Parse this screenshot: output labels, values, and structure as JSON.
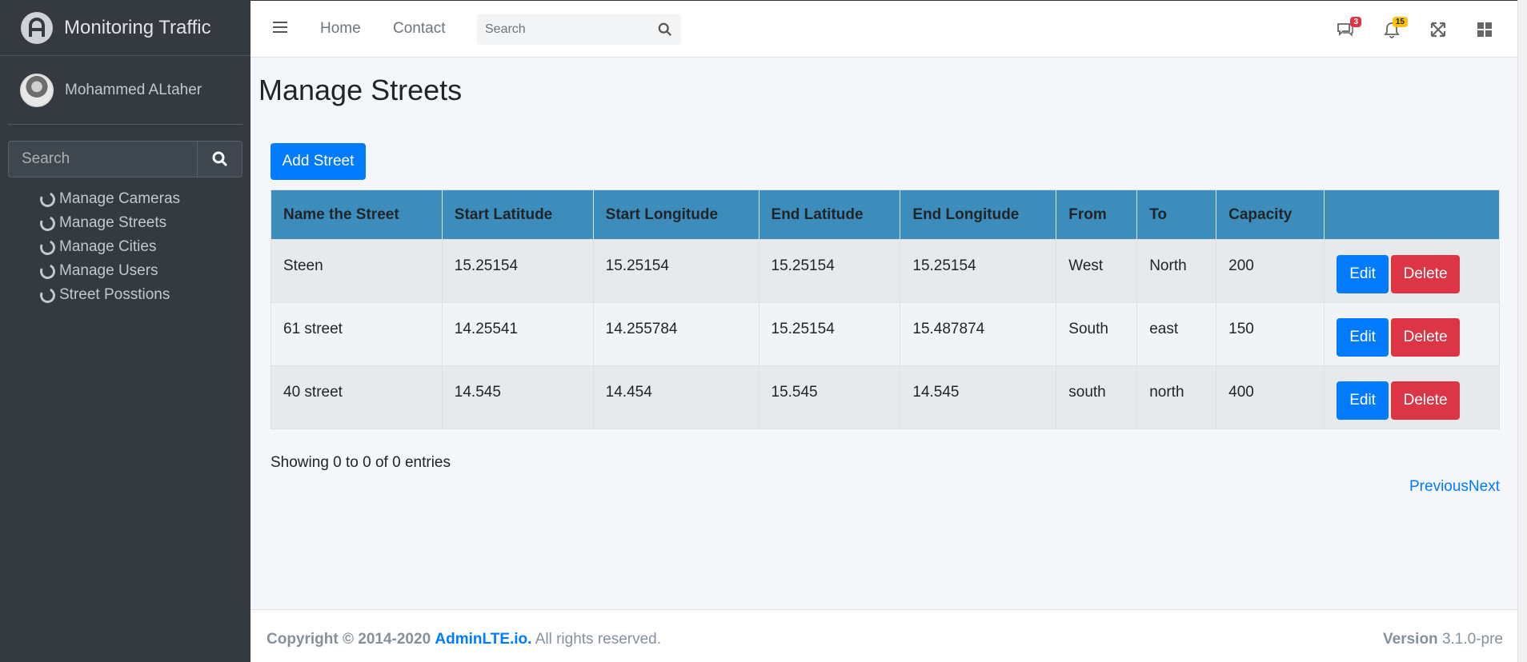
{
  "brand": {
    "title": "Monitoring Traffic"
  },
  "user": {
    "name": "Mohammed ALtaher"
  },
  "sidebar": {
    "search_placeholder": "Search",
    "items": [
      {
        "label": "Manage Cameras"
      },
      {
        "label": "Manage Streets"
      },
      {
        "label": "Manage Cities"
      },
      {
        "label": "Manage Users"
      },
      {
        "label": "Street Posstions"
      }
    ]
  },
  "navbar": {
    "links": [
      {
        "label": "Home"
      },
      {
        "label": "Contact"
      }
    ],
    "search_placeholder": "Search",
    "messages_badge": "3",
    "notifications_badge": "15"
  },
  "page": {
    "title": "Manage Streets",
    "add_button": "Add Street",
    "columns": [
      "Name the Street",
      "Start Latitude",
      "Start Longitude",
      "End Latitude",
      "End Longitude",
      "From",
      "To",
      "Capacity",
      ""
    ],
    "rows": [
      {
        "name": "Steen",
        "start_lat": "15.25154",
        "start_lng": "15.25154",
        "end_lat": "15.25154",
        "end_lng": "15.25154",
        "from": "West",
        "to": "North",
        "capacity": "200"
      },
      {
        "name": "61 street",
        "start_lat": "14.25541",
        "start_lng": "14.255784",
        "end_lat": "15.25154",
        "end_lng": "15.487874",
        "from": "South",
        "to": "east",
        "capacity": "150"
      },
      {
        "name": "40 street",
        "start_lat": "14.545",
        "start_lng": "14.454",
        "end_lat": "15.545",
        "end_lng": "14.545",
        "from": "south",
        "to": "north",
        "capacity": "400"
      }
    ],
    "edit_label": "Edit",
    "delete_label": "Delete",
    "info": "Showing 0 to 0 of 0 entries",
    "previous": "Previous",
    "next": "Next"
  },
  "footer": {
    "copyright": "Copyright © 2014-2020",
    "link": "AdminLTE.io.",
    "rights": "All rights reserved.",
    "version_label": "Version",
    "version": "3.1.0-pre"
  },
  "colors": {
    "primary": "#007bff",
    "danger": "#dc3545",
    "header": "#3c8dbc",
    "sidebar": "#343a40"
  }
}
